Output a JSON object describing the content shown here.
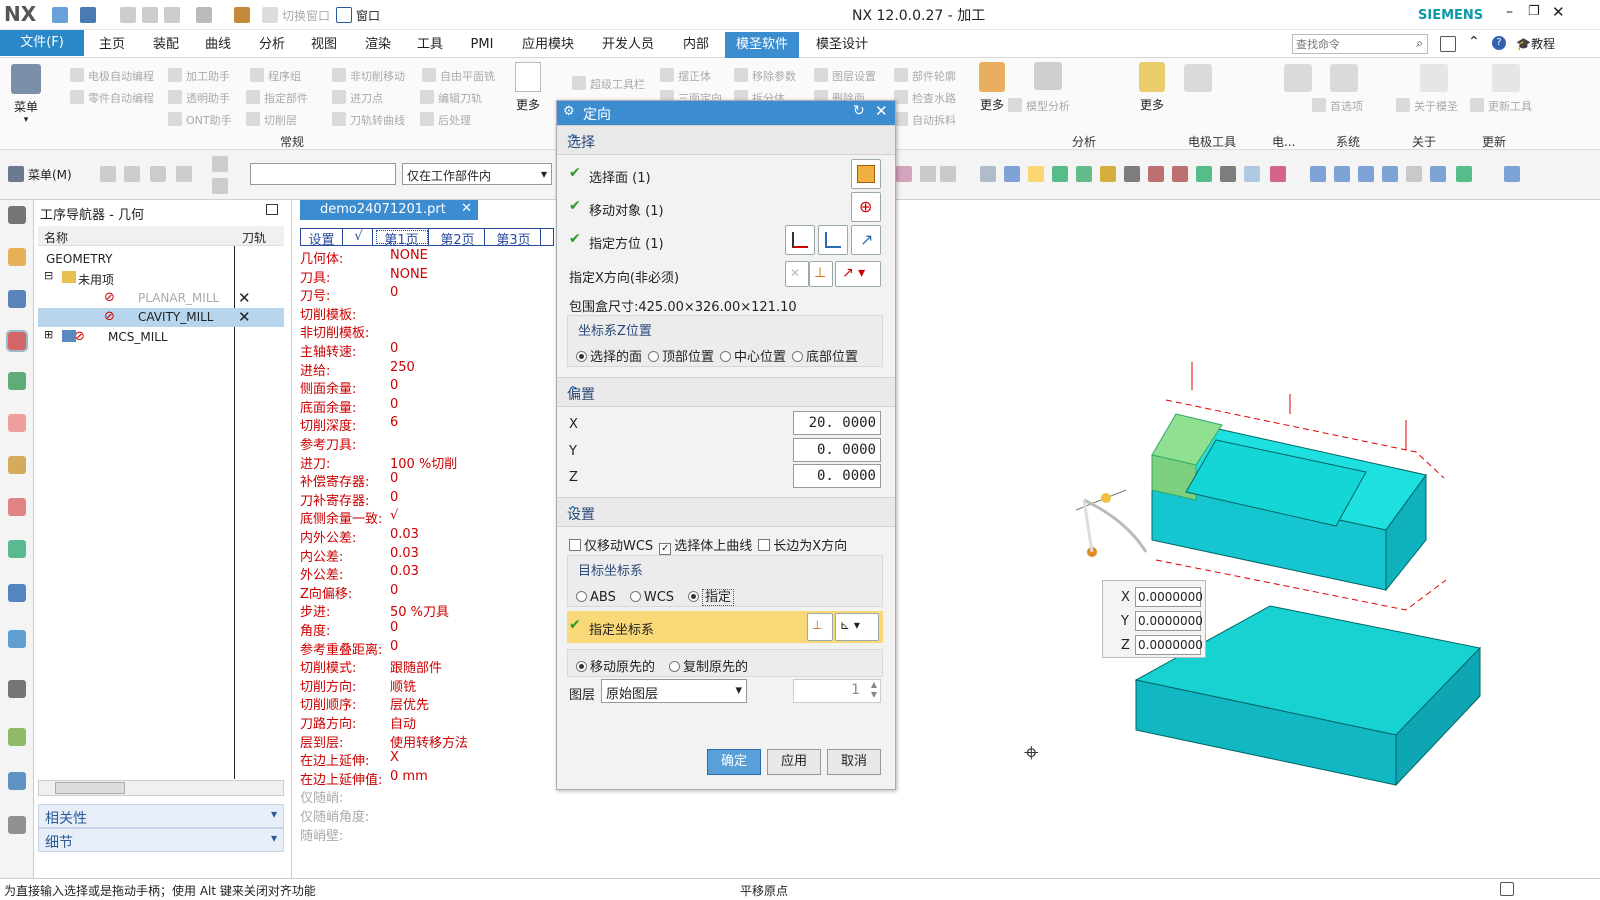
{
  "app": {
    "logo": "NX",
    "title": "NX 12.0.0.27 - 加工",
    "brand": "SIEMENS",
    "quick": {
      "switch_window": "切换窗口",
      "window": "窗口"
    }
  },
  "menubar": {
    "file": "文件(F)",
    "tabs": [
      "主页",
      "装配",
      "曲线",
      "分析",
      "视图",
      "渲染",
      "工具",
      "PMI",
      "应用模块",
      "开发人员",
      "内部",
      "模圣软件",
      "模圣设计"
    ],
    "active_tab": "模圣软件",
    "search_placeholder": "查找命令",
    "tutorial": "教程"
  },
  "ribbon": {
    "menu_label": "菜单",
    "items": [
      "电极自动编程",
      "加工助手",
      "程序组",
      "非切削移动",
      "自由平面铣",
      "零件自动编程",
      "透明助手",
      "指定部件",
      "进刀点",
      "编辑刀轨",
      "ONT助手",
      "切削层",
      "刀轨转曲线",
      "后处理",
      "超级工具栏",
      "摆正体",
      "移除参数",
      "图层设置",
      "部件轮廓",
      "三面定向",
      "拆分体",
      "删除面",
      "检查水路",
      "自动拆料",
      "模型分析",
      "首选项",
      "关于模圣",
      "更新工具"
    ],
    "more": "更多",
    "groups": [
      "常规",
      "分析",
      "电极工具",
      "电...",
      "系统",
      "关于",
      "更新"
    ]
  },
  "toolbar2": {
    "menu_btn": "菜单(M)",
    "filter_value": "仅在工作部件内"
  },
  "navigator": {
    "title": "工序导航器 - 几何",
    "col_name": "名称",
    "col_path": "刀轨",
    "rows": [
      {
        "name": "GEOMETRY"
      },
      {
        "name": "未用项"
      },
      {
        "name": "PLANAR_MILL",
        "mark": "✕"
      },
      {
        "name": "CAVITY_MILL",
        "mark": "✕"
      },
      {
        "name": "MCS_MILL"
      }
    ],
    "footer": [
      "相关性",
      "细节"
    ]
  },
  "editor": {
    "tab_name": "demo24071201.prt",
    "page_tabs": [
      "设置",
      "√",
      "第1页",
      "第2页",
      "第3页"
    ],
    "rows": [
      {
        "k": "几何体:",
        "v": "NONE"
      },
      {
        "k": "刀具:",
        "v": "NONE"
      },
      {
        "k": "刀号:",
        "v": "0"
      },
      {
        "k": "切削模板:",
        "v": ""
      },
      {
        "k": "非切削模板:",
        "v": ""
      },
      {
        "k": "主轴转速:",
        "v": "0"
      },
      {
        "k": "进给:",
        "v": "250"
      },
      {
        "k": "侧面余量:",
        "v": "0"
      },
      {
        "k": "底面余量:",
        "v": "0"
      },
      {
        "k": "切削深度:",
        "v": "6"
      },
      {
        "k": "参考刀具:",
        "v": ""
      },
      {
        "k": "进刀:",
        "v": "100   %切削"
      },
      {
        "k": "补偿寄存器:",
        "v": "0"
      },
      {
        "k": "刀补寄存器:",
        "v": "0"
      },
      {
        "k": "底侧余量一致:",
        "v": "√"
      },
      {
        "k": "内外公差:",
        "v": "0.03"
      },
      {
        "k": "内公差:",
        "v": "0.03"
      },
      {
        "k": "外公差:",
        "v": "0.03"
      },
      {
        "k": "Z向偏移:",
        "v": "0"
      },
      {
        "k": "步进:",
        "v": "50    %刀具"
      },
      {
        "k": "角度:",
        "v": "0"
      },
      {
        "k": "参考重叠距离:",
        "v": "0"
      },
      {
        "k": "切削模式:",
        "v": "跟随部件"
      },
      {
        "k": "切削方向:",
        "v": "顺铣"
      },
      {
        "k": "切削顺序:",
        "v": "层优先"
      },
      {
        "k": "刀路方向:",
        "v": "自动"
      },
      {
        "k": "层到层:",
        "v": "使用转移方法"
      },
      {
        "k": "在边上延伸:",
        "v": "X"
      },
      {
        "k": "在边上延伸值:",
        "v": "0     mm"
      },
      {
        "k": "仅随峭:",
        "v": ""
      },
      {
        "k": "仅随峭角度:",
        "v": ""
      },
      {
        "k": "随峭壁:",
        "v": ""
      }
    ]
  },
  "dialog": {
    "title": "定向",
    "sec_select": "选择",
    "select_face": "选择面 (1)",
    "move_obj": "移动对象 (1)",
    "spec_orient": "指定方位 (1)",
    "spec_x": "指定X方向(非必须)",
    "bbox": "包围盒尺寸:425.00×326.00×121.10",
    "zpos_title": "坐标系Z位置",
    "zpos_opts": [
      "选择的面",
      "顶部位置",
      "中心位置",
      "底部位置"
    ],
    "sec_offset": "偏置",
    "x_label": "X",
    "x_val": "20. 0000",
    "y_label": "Y",
    "y_val": "0. 0000",
    "z_label": "Z",
    "z_val": "0. 0000",
    "sec_settings": "设置",
    "cb_opts": [
      "仅移动WCS",
      "选择体上曲线",
      "长边为X方向"
    ],
    "target_title": "目标坐标系",
    "target_opts": [
      "ABS",
      "WCS",
      "指定"
    ],
    "spec_csys": "指定坐标系",
    "move_opts": [
      "移动原先的",
      "复制原先的"
    ],
    "layer_label": "图层",
    "layer_value": "原始图层",
    "layer_num": "1",
    "ok": "确定",
    "apply": "应用",
    "cancel": "取消"
  },
  "viewport": {
    "coord_x_label": "X",
    "coord_x": "0.0000000",
    "coord_y_label": "Y",
    "coord_y": "0.0000000",
    "coord_z_label": "Z",
    "coord_z": "0.0000000"
  },
  "status": {
    "left": "为直接输入选择或是拖动手柄；使用 Alt 键来关闭对齐功能",
    "center": "平移原点"
  },
  "colors": {
    "accent": "#2b88c8",
    "active_tab_bg": "#3b8dd0",
    "highlight": "#f8d877",
    "part": "#1ee0e0"
  }
}
